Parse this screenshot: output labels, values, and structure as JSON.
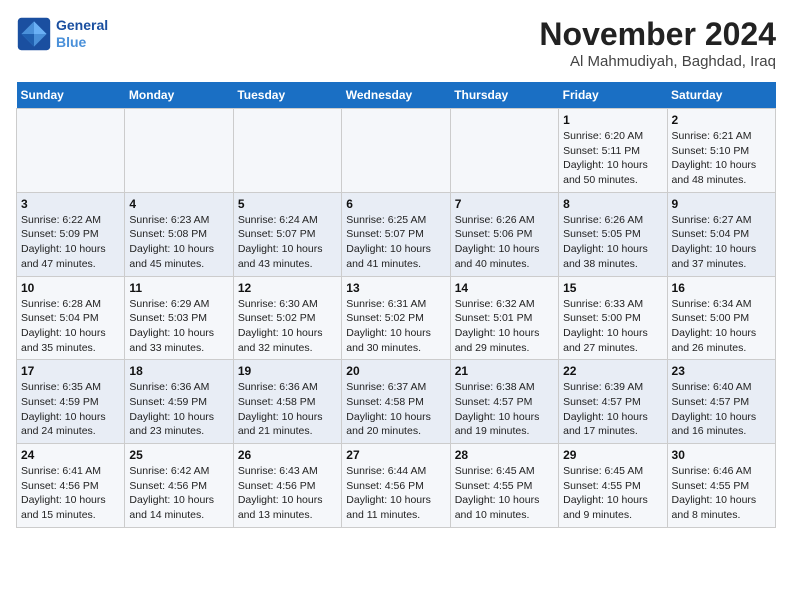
{
  "header": {
    "logo_line1": "General",
    "logo_line2": "Blue",
    "month": "November 2024",
    "location": "Al Mahmudiyah, Baghdad, Iraq"
  },
  "weekdays": [
    "Sunday",
    "Monday",
    "Tuesday",
    "Wednesday",
    "Thursday",
    "Friday",
    "Saturday"
  ],
  "weeks": [
    [
      {
        "day": "",
        "info": ""
      },
      {
        "day": "",
        "info": ""
      },
      {
        "day": "",
        "info": ""
      },
      {
        "day": "",
        "info": ""
      },
      {
        "day": "",
        "info": ""
      },
      {
        "day": "1",
        "info": "Sunrise: 6:20 AM\nSunset: 5:11 PM\nDaylight: 10 hours\nand 50 minutes."
      },
      {
        "day": "2",
        "info": "Sunrise: 6:21 AM\nSunset: 5:10 PM\nDaylight: 10 hours\nand 48 minutes."
      }
    ],
    [
      {
        "day": "3",
        "info": "Sunrise: 6:22 AM\nSunset: 5:09 PM\nDaylight: 10 hours\nand 47 minutes."
      },
      {
        "day": "4",
        "info": "Sunrise: 6:23 AM\nSunset: 5:08 PM\nDaylight: 10 hours\nand 45 minutes."
      },
      {
        "day": "5",
        "info": "Sunrise: 6:24 AM\nSunset: 5:07 PM\nDaylight: 10 hours\nand 43 minutes."
      },
      {
        "day": "6",
        "info": "Sunrise: 6:25 AM\nSunset: 5:07 PM\nDaylight: 10 hours\nand 41 minutes."
      },
      {
        "day": "7",
        "info": "Sunrise: 6:26 AM\nSunset: 5:06 PM\nDaylight: 10 hours\nand 40 minutes."
      },
      {
        "day": "8",
        "info": "Sunrise: 6:26 AM\nSunset: 5:05 PM\nDaylight: 10 hours\nand 38 minutes."
      },
      {
        "day": "9",
        "info": "Sunrise: 6:27 AM\nSunset: 5:04 PM\nDaylight: 10 hours\nand 37 minutes."
      }
    ],
    [
      {
        "day": "10",
        "info": "Sunrise: 6:28 AM\nSunset: 5:04 PM\nDaylight: 10 hours\nand 35 minutes."
      },
      {
        "day": "11",
        "info": "Sunrise: 6:29 AM\nSunset: 5:03 PM\nDaylight: 10 hours\nand 33 minutes."
      },
      {
        "day": "12",
        "info": "Sunrise: 6:30 AM\nSunset: 5:02 PM\nDaylight: 10 hours\nand 32 minutes."
      },
      {
        "day": "13",
        "info": "Sunrise: 6:31 AM\nSunset: 5:02 PM\nDaylight: 10 hours\nand 30 minutes."
      },
      {
        "day": "14",
        "info": "Sunrise: 6:32 AM\nSunset: 5:01 PM\nDaylight: 10 hours\nand 29 minutes."
      },
      {
        "day": "15",
        "info": "Sunrise: 6:33 AM\nSunset: 5:00 PM\nDaylight: 10 hours\nand 27 minutes."
      },
      {
        "day": "16",
        "info": "Sunrise: 6:34 AM\nSunset: 5:00 PM\nDaylight: 10 hours\nand 26 minutes."
      }
    ],
    [
      {
        "day": "17",
        "info": "Sunrise: 6:35 AM\nSunset: 4:59 PM\nDaylight: 10 hours\nand 24 minutes."
      },
      {
        "day": "18",
        "info": "Sunrise: 6:36 AM\nSunset: 4:59 PM\nDaylight: 10 hours\nand 23 minutes."
      },
      {
        "day": "19",
        "info": "Sunrise: 6:36 AM\nSunset: 4:58 PM\nDaylight: 10 hours\nand 21 minutes."
      },
      {
        "day": "20",
        "info": "Sunrise: 6:37 AM\nSunset: 4:58 PM\nDaylight: 10 hours\nand 20 minutes."
      },
      {
        "day": "21",
        "info": "Sunrise: 6:38 AM\nSunset: 4:57 PM\nDaylight: 10 hours\nand 19 minutes."
      },
      {
        "day": "22",
        "info": "Sunrise: 6:39 AM\nSunset: 4:57 PM\nDaylight: 10 hours\nand 17 minutes."
      },
      {
        "day": "23",
        "info": "Sunrise: 6:40 AM\nSunset: 4:57 PM\nDaylight: 10 hours\nand 16 minutes."
      }
    ],
    [
      {
        "day": "24",
        "info": "Sunrise: 6:41 AM\nSunset: 4:56 PM\nDaylight: 10 hours\nand 15 minutes."
      },
      {
        "day": "25",
        "info": "Sunrise: 6:42 AM\nSunset: 4:56 PM\nDaylight: 10 hours\nand 14 minutes."
      },
      {
        "day": "26",
        "info": "Sunrise: 6:43 AM\nSunset: 4:56 PM\nDaylight: 10 hours\nand 13 minutes."
      },
      {
        "day": "27",
        "info": "Sunrise: 6:44 AM\nSunset: 4:56 PM\nDaylight: 10 hours\nand 11 minutes."
      },
      {
        "day": "28",
        "info": "Sunrise: 6:45 AM\nSunset: 4:55 PM\nDaylight: 10 hours\nand 10 minutes."
      },
      {
        "day": "29",
        "info": "Sunrise: 6:45 AM\nSunset: 4:55 PM\nDaylight: 10 hours\nand 9 minutes."
      },
      {
        "day": "30",
        "info": "Sunrise: 6:46 AM\nSunset: 4:55 PM\nDaylight: 10 hours\nand 8 minutes."
      }
    ]
  ]
}
